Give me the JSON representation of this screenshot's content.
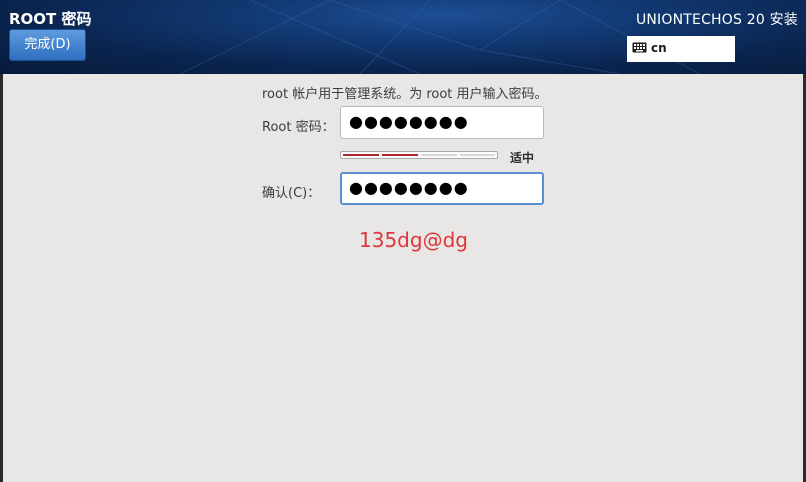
{
  "header": {
    "title": "ROOT 密码",
    "done_label": "完成(D)",
    "product_title": "UNIONTECHOS 20 安装",
    "keyboard_layout": "cn",
    "keyboard_icon": "keyboard-icon"
  },
  "form": {
    "instructions": "root 帐户用于管理系统。为 root 用户输入密码。",
    "root_label": "Root 密码：",
    "root_value": "●●●●●●●●",
    "strength_level": 0.5,
    "strength_label": "适中",
    "confirm_label": "确认(C)：",
    "confirm_value": "●●●●●●●●"
  },
  "annotation": "135dg@dg",
  "colors": {
    "header_dark": "#0b2550",
    "button_blue": "#3a7bd5",
    "strength_fill": "#b2282d",
    "focus_border": "#5b8fd1",
    "annotation_red": "#e0353b"
  }
}
